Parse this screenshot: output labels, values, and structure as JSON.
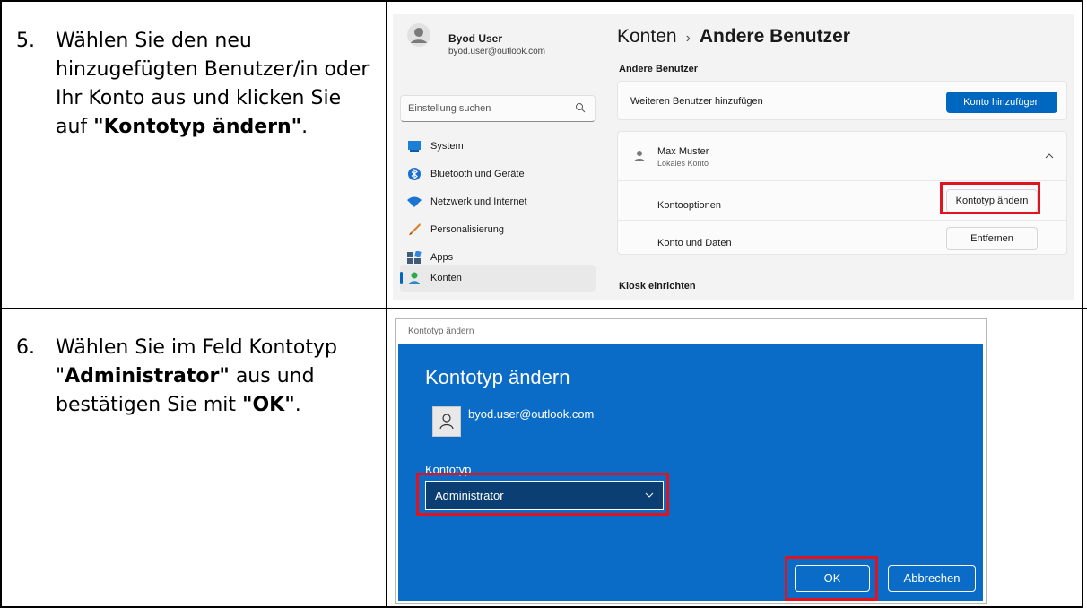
{
  "steps": [
    {
      "number": "5.",
      "text_1": "Wählen Sie den neu hinzugefügten Benutzer/in oder Ihr Konto aus und klicken Sie auf ",
      "bold_1": "\"Kontotyp ändern\"",
      "text_2": "."
    },
    {
      "number": "6.",
      "text_1": "Wählen Sie im Feld Kontotyp \"",
      "bold_1": "Administrator\"",
      "text_2": " aus und bestätigen Sie mit ",
      "bold_2": "\"OK\"",
      "text_3": "."
    }
  ],
  "settings": {
    "user": {
      "name": "Byod User",
      "email": "byod.user@outlook.com"
    },
    "search_placeholder": "Einstellung suchen",
    "nav": [
      {
        "label": "System",
        "icon": "system-icon"
      },
      {
        "label": "Bluetooth und Geräte",
        "icon": "bluetooth-icon"
      },
      {
        "label": "Netzwerk und Internet",
        "icon": "wifi-icon"
      },
      {
        "label": "Personalisierung",
        "icon": "brush-icon"
      },
      {
        "label": "Apps",
        "icon": "apps-icon"
      },
      {
        "label": "Konten",
        "icon": "accounts-icon",
        "active": true
      }
    ],
    "breadcrumb": {
      "parent": "Konten",
      "separator": "›",
      "current": "Andere Benutzer"
    },
    "section_title": "Andere Benutzer",
    "add_user": {
      "label": "Weiteren Benutzer hinzufügen",
      "button": "Konto hinzufügen"
    },
    "user_entry": {
      "name": "Max Muster",
      "type": "Lokales Konto"
    },
    "options": {
      "label": "Kontooptionen",
      "button": "Kontotyp ändern"
    },
    "data": {
      "label": "Konto und Daten",
      "button": "Entfernen"
    },
    "kiosk": "Kiosk einrichten",
    "accent": "#0067c0",
    "highlight": "#e0141e"
  },
  "dialog": {
    "window_title": "Kontotyp ändern",
    "heading": "Kontotyp ändern",
    "account": "byod.user@outlook.com",
    "field_label": "Kontotyp",
    "selected": "Administrator",
    "ok": "OK",
    "cancel": "Abbrechen",
    "bg": "#0a6cc7"
  }
}
